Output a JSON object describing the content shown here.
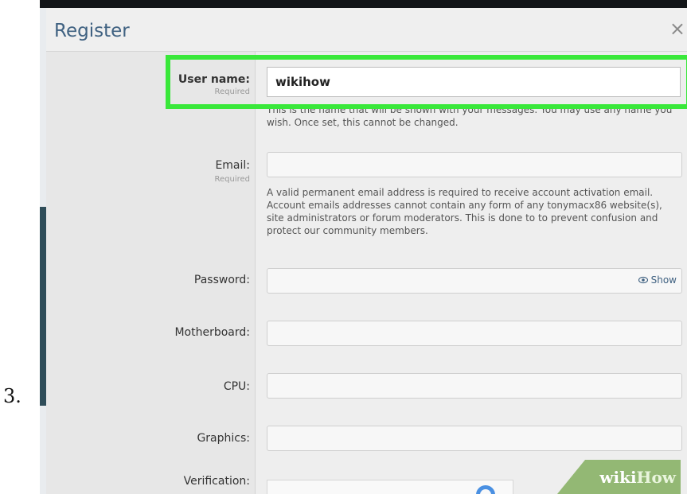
{
  "step_number": "3.",
  "dialog": {
    "title": "Register",
    "close_symbol": "×"
  },
  "form": {
    "username": {
      "label": "User name:",
      "sublabel": "Required",
      "value": "wikihow",
      "help": "This is the name that will be shown with your messages. You may use any name you wish. Once set, this cannot be changed."
    },
    "email": {
      "label": "Email:",
      "sublabel": "Required",
      "value": "",
      "help": "A valid permanent email address is required to receive account activation email. Account emails addresses cannot contain any form of any tonymacx86 website(s), site administrators or forum moderators. This is done to to prevent confusion and protect our community members."
    },
    "password": {
      "label": "Password:",
      "value": "",
      "show_label": "Show"
    },
    "motherboard": {
      "label": "Motherboard:",
      "value": ""
    },
    "cpu": {
      "label": "CPU:",
      "value": ""
    },
    "graphics": {
      "label": "Graphics:",
      "value": ""
    },
    "verification": {
      "label": "Verification:"
    }
  },
  "highlight_color": "#39e83a",
  "accent_color": "#3f6181",
  "watermark": {
    "part1": "wiki",
    "part2": "How"
  }
}
